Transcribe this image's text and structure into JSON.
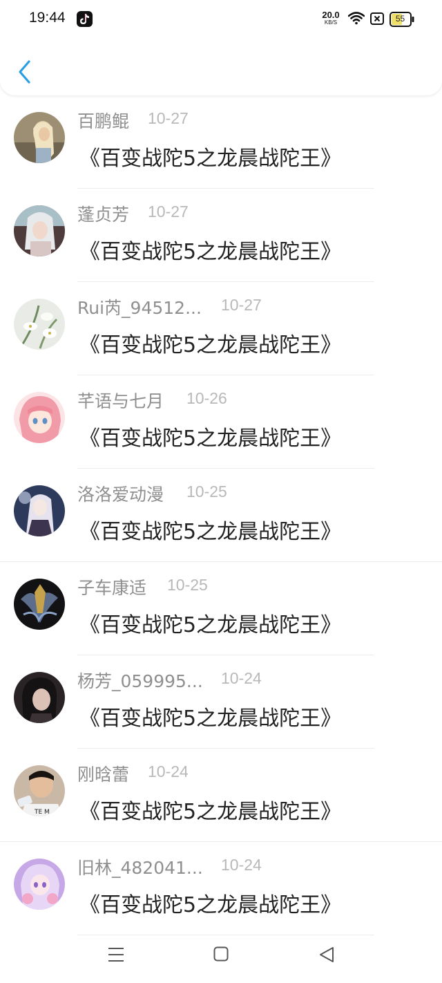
{
  "status_bar": {
    "time": "19:44",
    "app_icon": "tiktok-icon",
    "net_speed_value": "20.0",
    "net_speed_unit": "KB/S",
    "battery_level": "55"
  },
  "header": {
    "back_icon": "chevron-left-icon",
    "accent_color": "#2a9ee3"
  },
  "comments": [
    {
      "user": "百鹏鲲",
      "date": "10-27",
      "text": "《百变战陀5之龙晨战陀王》"
    },
    {
      "user": "蓬贞芳",
      "date": "10-27",
      "text": "《百变战陀5之龙晨战陀王》"
    },
    {
      "user": "Rui芮_94512...",
      "date": "10-27",
      "text": "《百变战陀5之龙晨战陀王》"
    },
    {
      "user": "芊语与七月",
      "date": "10-26",
      "text": "《百变战陀5之龙晨战陀王》"
    },
    {
      "user": "洛洛爱动漫",
      "date": "10-25",
      "text": "《百变战陀5之龙晨战陀王》"
    },
    {
      "user": "子车康适",
      "date": "10-25",
      "text": "《百变战陀5之龙晨战陀王》"
    },
    {
      "user": "杨芳_059995...",
      "date": "10-24",
      "text": "《百变战陀5之龙晨战陀王》"
    },
    {
      "user": "刚晗蕾",
      "date": "10-24",
      "text": "《百变战陀5之龙晨战陀王》"
    },
    {
      "user": "旧林_482041...",
      "date": "10-24",
      "text": "《百变战陀5之龙晨战陀王》"
    }
  ],
  "nav_bar": {
    "menu_icon": "menu-icon",
    "home_icon": "home-square-icon",
    "back_icon": "back-triangle-icon"
  }
}
